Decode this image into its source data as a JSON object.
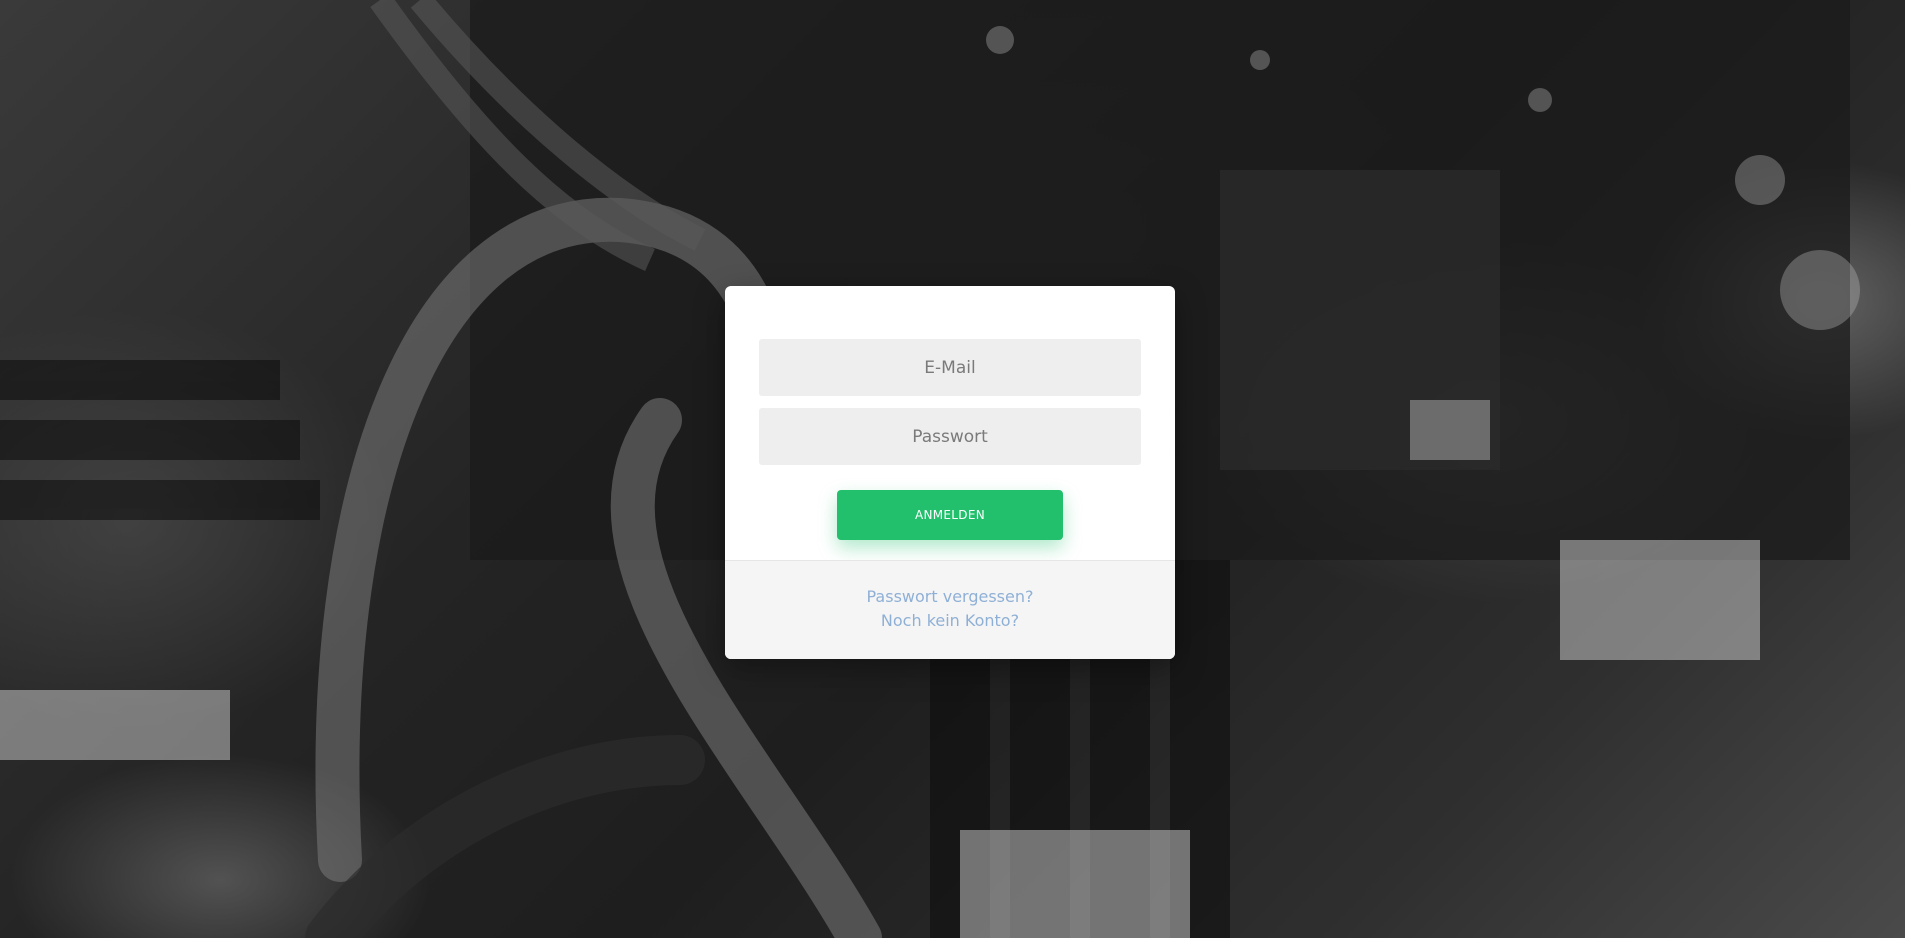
{
  "login_form": {
    "email_placeholder": "E-Mail",
    "password_placeholder": "Passwort",
    "submit_label": "ANMELDEN"
  },
  "footer": {
    "forgot_password_label": "Passwort vergessen?",
    "register_label": "Noch kein Konto?"
  },
  "colors": {
    "button": "#22c06c",
    "link": "#8fb0d6",
    "input_background": "#eeeeee",
    "footer_background": "#f5f5f5"
  }
}
